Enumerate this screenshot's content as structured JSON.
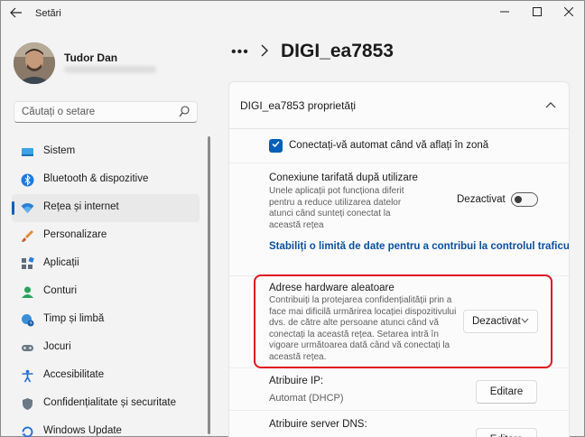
{
  "window": {
    "app_title": "Setări",
    "minimize_glyph": "—",
    "maximize_glyph": "☐",
    "close_glyph": "✕"
  },
  "user": {
    "name": "Tudor Dan"
  },
  "search": {
    "placeholder": "Căutați o setare"
  },
  "sidebar": {
    "items": [
      {
        "label": "Sistem",
        "icon": "system-icon",
        "active": false
      },
      {
        "label": "Bluetooth & dispozitive",
        "icon": "bluetooth-icon",
        "active": false
      },
      {
        "label": "Rețea și internet",
        "icon": "network-icon",
        "active": true
      },
      {
        "label": "Personalizare",
        "icon": "brush-icon",
        "active": false
      },
      {
        "label": "Aplicații",
        "icon": "apps-icon",
        "active": false
      },
      {
        "label": "Conturi",
        "icon": "account-icon",
        "active": false
      },
      {
        "label": "Timp și limbă",
        "icon": "globe-clock-icon",
        "active": false
      },
      {
        "label": "Jocuri",
        "icon": "gamepad-icon",
        "active": false
      },
      {
        "label": "Accesibilitate",
        "icon": "accessibility-icon",
        "active": false
      },
      {
        "label": "Confidențialitate și securitate",
        "icon": "shield-icon",
        "active": false
      },
      {
        "label": "Windows Update",
        "icon": "update-icon",
        "active": false
      }
    ]
  },
  "breadcrumb": {
    "title": "DIGI_ea7853"
  },
  "panel": {
    "title": "DIGI_ea7853 proprietăți",
    "auto_connect": {
      "label": "Conectați-vă automat când vă aflați în zonă",
      "checked": true
    },
    "metered": {
      "title": "Conexiune tarifată după utilizare",
      "description": "Unele aplicații pot funcționa diferit pentru a reduce utilizarea datelor atunci când sunteți conectat la această rețea",
      "state_label": "Dezactivat",
      "on": false
    },
    "data_limit_link": "Stabiliți o limită de date pentru a contribui la controlul traficului",
    "random_hw": {
      "title": "Adrese hardware aleatoare",
      "description": "Contribuiți la protejarea confidențialității prin a face mai dificilă urmărirea locației dispozitivului dvs. de către alte persoane atunci când vă conectați la această rețea. Setarea intră în vigoare următoarea dată când vă conectați la această rețea.",
      "selected": "Dezactivat"
    },
    "ip": {
      "title": "Atribuire IP:",
      "value": "Automat (DHCP)",
      "button": "Editare"
    },
    "dns": {
      "title": "Atribuire server DNS:",
      "button": "Editare"
    }
  },
  "colors": {
    "accent": "#005fb8",
    "highlight": "#e0141e"
  }
}
